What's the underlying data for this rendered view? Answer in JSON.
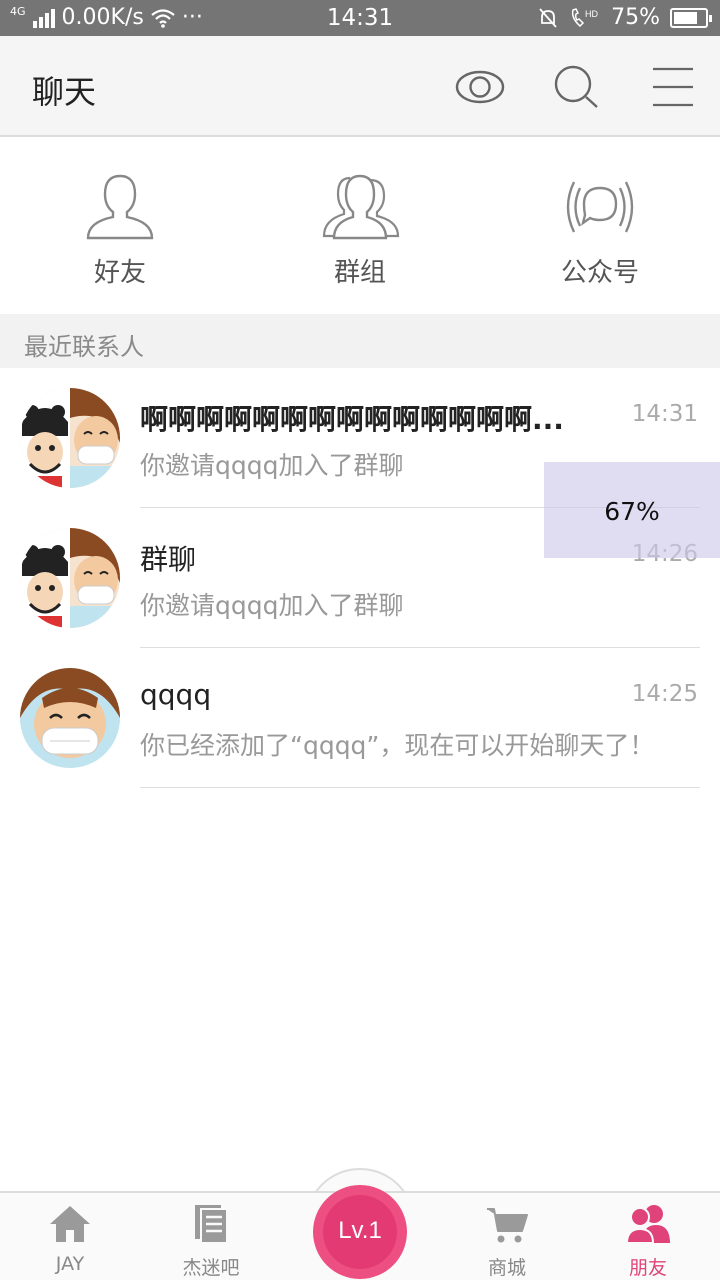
{
  "status_bar": {
    "network": "4G",
    "speed": "0.00K/s",
    "more": "···",
    "time": "14:31",
    "battery": "75%",
    "battery_level": 0.75,
    "hd": "HD"
  },
  "header": {
    "title": "聊天",
    "icons": [
      "eye-icon",
      "search-icon",
      "menu-icon"
    ]
  },
  "quick_entries": [
    {
      "label": "好友",
      "icon": "person-icon"
    },
    {
      "label": "群组",
      "icon": "group-icon"
    },
    {
      "label": "公众号",
      "icon": "broadcast-icon"
    }
  ],
  "section": {
    "title": "最近联系人"
  },
  "chats": [
    {
      "name": "啊啊啊啊啊啊啊啊啊啊啊啊啊啊...",
      "message": "你邀请qqqq加入了群聊",
      "time": "14:31",
      "avatar": "group-avatar"
    },
    {
      "name": "群聊",
      "message": "你邀请qqqq加入了群聊",
      "time": "14:26",
      "avatar": "group-avatar"
    },
    {
      "name": "qqqq",
      "message": "你已经添加了“qqqq”，现在可以开始聊天了！",
      "time": "14:25",
      "avatar": "user-avatar"
    }
  ],
  "overlay": {
    "text": "67%"
  },
  "tabbar": {
    "tabs": [
      {
        "label": "JAY",
        "icon": "home-icon"
      },
      {
        "label": "杰迷吧",
        "icon": "document-icon"
      },
      {
        "label": "商城",
        "icon": "cart-icon"
      },
      {
        "label": "朋友",
        "icon": "friends-icon"
      }
    ],
    "center": "Lv.1",
    "active_color": "#e0437a",
    "inactive_color": "#888888"
  }
}
